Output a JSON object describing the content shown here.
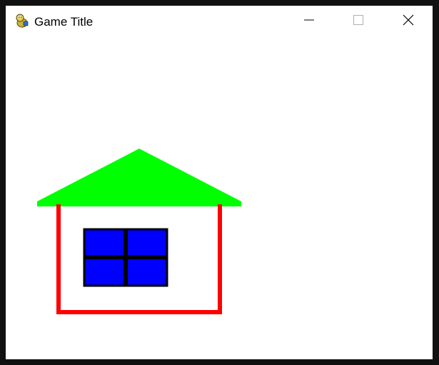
{
  "window": {
    "title": "Game Title",
    "controls": {
      "minimize": "minimize-icon",
      "maximize": "maximize-icon",
      "close": "close-icon"
    },
    "app_icon": "python-snake-icon"
  },
  "scene": {
    "background": "#ffffff",
    "roof_color": "#00ff00",
    "walls_color": "#ff0000",
    "window_glass_color": "#0000ff",
    "window_frame_color": "#000000"
  }
}
